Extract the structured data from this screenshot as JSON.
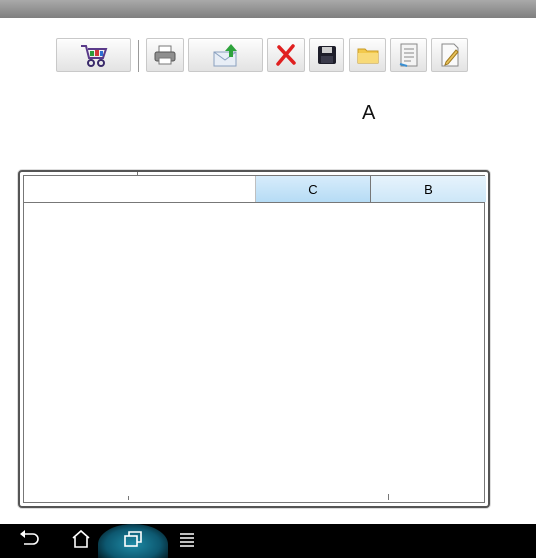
{
  "toolbar": {
    "buttons": [
      {
        "name": "shopping-cart",
        "icon": "cart-icon"
      },
      {
        "name": "print",
        "icon": "printer-icon"
      },
      {
        "name": "send-mail",
        "icon": "mail-upload-icon"
      },
      {
        "name": "delete",
        "icon": "close-icon"
      },
      {
        "name": "save",
        "icon": "floppy-icon"
      },
      {
        "name": "open-folder",
        "icon": "folder-icon"
      },
      {
        "name": "report",
        "icon": "document-list-icon"
      },
      {
        "name": "edit-note",
        "icon": "note-edit-icon"
      }
    ]
  },
  "annotation": {
    "label": "A"
  },
  "grid": {
    "columns": [
      "",
      "C",
      "B"
    ]
  },
  "navbar": {
    "buttons": [
      "back-icon",
      "home-icon",
      "recents-icon",
      "menu-icon"
    ]
  },
  "colors": {
    "header_c": "#b6dcf5",
    "header_b": "#cde7f8",
    "recents_highlight": "#1e8aa5"
  }
}
